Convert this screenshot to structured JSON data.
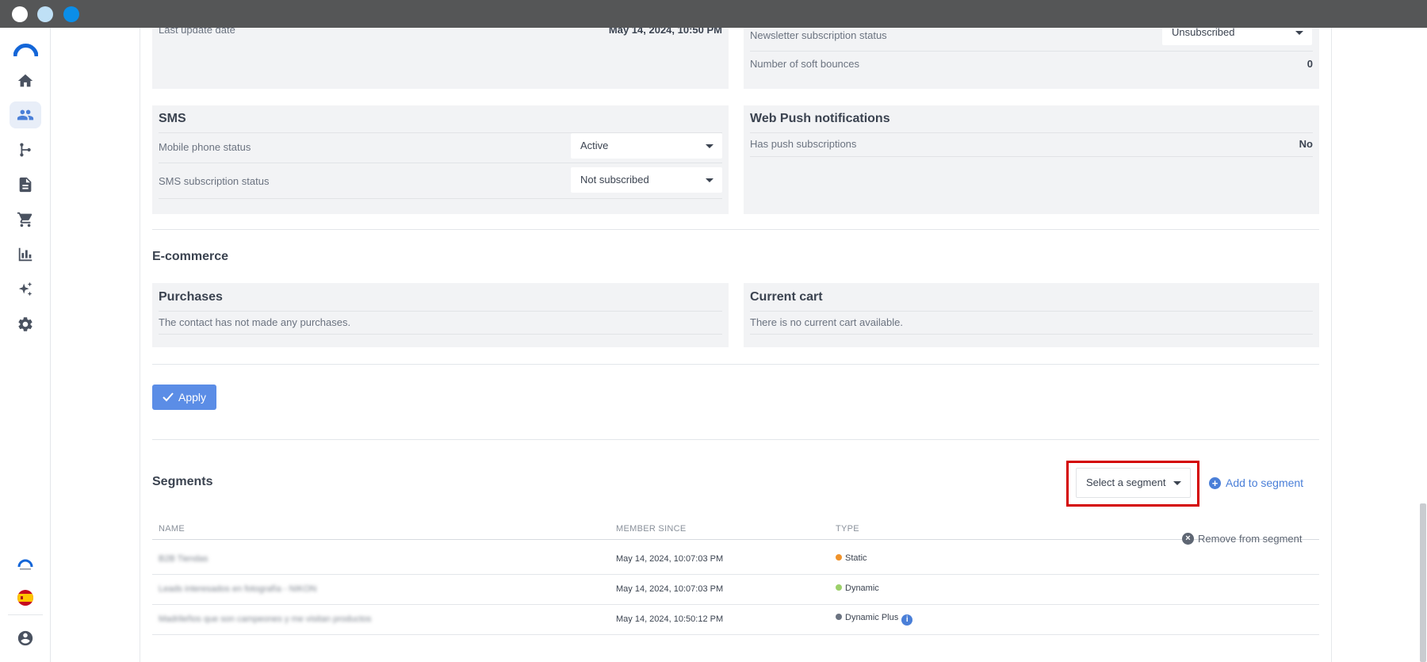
{
  "sidebar": {
    "items": [
      {
        "name": "home"
      },
      {
        "name": "contacts",
        "active": true
      },
      {
        "name": "automations"
      },
      {
        "name": "templates"
      },
      {
        "name": "ecommerce"
      },
      {
        "name": "statistics"
      },
      {
        "name": "ai"
      },
      {
        "name": "settings"
      }
    ]
  },
  "email": {
    "last_update_label": "Last update date",
    "last_update_value": "May 14, 2024, 10:50 PM",
    "newsletter_label": "Newsletter subscription status",
    "newsletter_value": "Unsubscribed",
    "soft_bounces_label": "Number of soft bounces",
    "soft_bounces_value": "0"
  },
  "sms": {
    "title": "SMS",
    "mobile_label": "Mobile phone status",
    "mobile_value": "Active",
    "subscription_label": "SMS subscription status",
    "subscription_value": "Not subscribed"
  },
  "webpush": {
    "title": "Web Push notifications",
    "has_push_label": "Has push subscriptions",
    "has_push_value": "No"
  },
  "ecommerce": {
    "title": "E-commerce",
    "purchases_title": "Purchases",
    "purchases_text": "The contact has not made any purchases.",
    "cart_title": "Current cart",
    "cart_text": "There is no current cart available."
  },
  "apply_label": "Apply",
  "segments": {
    "title": "Segments",
    "select_placeholder": "Select a segment",
    "add_label": "Add to segment",
    "columns": [
      "NAME",
      "MEMBER SINCE",
      "TYPE"
    ],
    "rows": [
      {
        "name": "B2B Tiendas",
        "since": "May 14, 2024, 10:07:03 PM",
        "type": "Static",
        "type_color": "#f0932b"
      },
      {
        "name": "Leads interesados en fotografía - NIKON",
        "since": "May 14, 2024, 10:07:03 PM",
        "type": "Dynamic",
        "type_color": "#9cd06a"
      },
      {
        "name": "Madrileños que son campeones y me visitan productos",
        "since": "May 14, 2024, 10:50:12 PM",
        "type": "Dynamic Plus",
        "type_color": "#6b7380"
      }
    ],
    "remove_label": "Remove from segment"
  },
  "colors": {
    "accent": "#4a7fd8",
    "button": "#5b8de6",
    "highlight": "#d40000"
  }
}
